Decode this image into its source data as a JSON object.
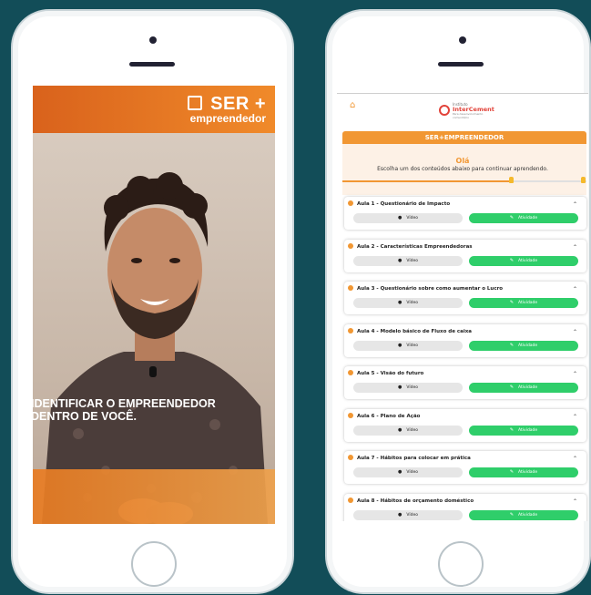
{
  "left_screen": {
    "brand_main": "SER +",
    "brand_sub": "empreendedor",
    "caption_line1": "IDENTIFICAR O EMPREENDEDOR",
    "caption_line2": "DENTRO DE VOCÊ."
  },
  "right_screen": {
    "home_icon": "home-icon",
    "logo_line1": "Instituto",
    "logo_line2": "InterCement",
    "logo_line3": "Para desenvolvimento comunitário",
    "header": "SER+EMPREENDEDOR",
    "greeting": "Olá",
    "subtitle": "Escolha um dos conteúdos abaixo para continuar aprendendo.",
    "progress_fraction": 0.69,
    "lessons": [
      {
        "title": "Aula 1 - Questionário de Impacto",
        "video": "Vídeo",
        "activity": "Atividade"
      },
      {
        "title": "Aula 2 - Características Empreendedoras",
        "video": "Vídeo",
        "activity": "Atividade"
      },
      {
        "title": "Aula 3 - Questionário sobre como aumentar o Lucro",
        "video": "Vídeo",
        "activity": "Atividade"
      },
      {
        "title": "Aula 4 - Modelo básico de Fluxo de caixa",
        "video": "Vídeo",
        "activity": "Atividade"
      },
      {
        "title": "Aula 5 - Visão do futuro",
        "video": "Vídeo",
        "activity": "Atividade"
      },
      {
        "title": "Aula 6 - Plano de Ação",
        "video": "Vídeo",
        "activity": "Atividade"
      },
      {
        "title": "Aula 7 - Hábitos para colocar em prática",
        "video": "Vídeo",
        "activity": "Atividade"
      },
      {
        "title": "Aula 8 - Hábitos de orçamento doméstico",
        "video": "Vídeo",
        "activity": "Atividade"
      }
    ]
  },
  "colors": {
    "background": "#124d58",
    "orange": "#f19733",
    "green": "#2fce6a"
  }
}
